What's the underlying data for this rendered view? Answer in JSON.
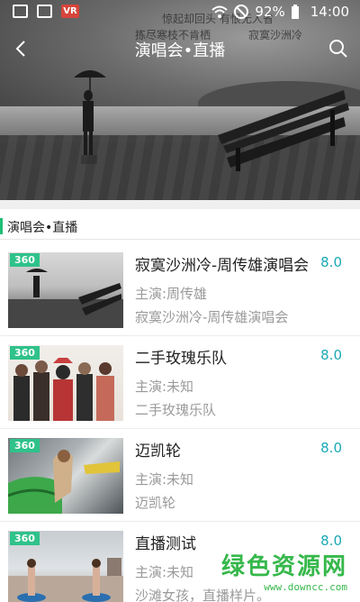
{
  "status_bar": {
    "battery": "92%",
    "time": "14:00",
    "vr_label": "VR"
  },
  "header": {
    "title": "演唱会•直播",
    "poem_line1": "惊起却回头 有恨无人省",
    "poem_line2": "拣尽寒枝不肯栖",
    "poem_line3": "寂寞沙洲冷"
  },
  "section": {
    "title": "演唱会•直播"
  },
  "items": [
    {
      "badge": "360",
      "name": "寂寞沙洲冷-周传雄演唱会",
      "score": "8.0",
      "actor": "主演:周传雄",
      "desc": "寂寞沙洲冷-周传雄演唱会"
    },
    {
      "badge": "360",
      "name": "二手玫瑰乐队",
      "score": "8.0",
      "actor": "主演:未知",
      "desc": "二手玫瑰乐队"
    },
    {
      "badge": "360",
      "name": "迈凯轮",
      "score": "8.0",
      "actor": "主演:未知",
      "desc": "迈凯轮"
    },
    {
      "badge": "360",
      "name": "直播测试",
      "score": "8.0",
      "actor": "主演:未知",
      "desc": "沙滩女孩，直播样片。"
    }
  ],
  "watermark": {
    "text": "绿色资源网",
    "url": "www.downcc.com"
  },
  "colors": {
    "accent": "#1fbf74",
    "score": "#1aa8b4",
    "badge": "#2fc28a"
  }
}
